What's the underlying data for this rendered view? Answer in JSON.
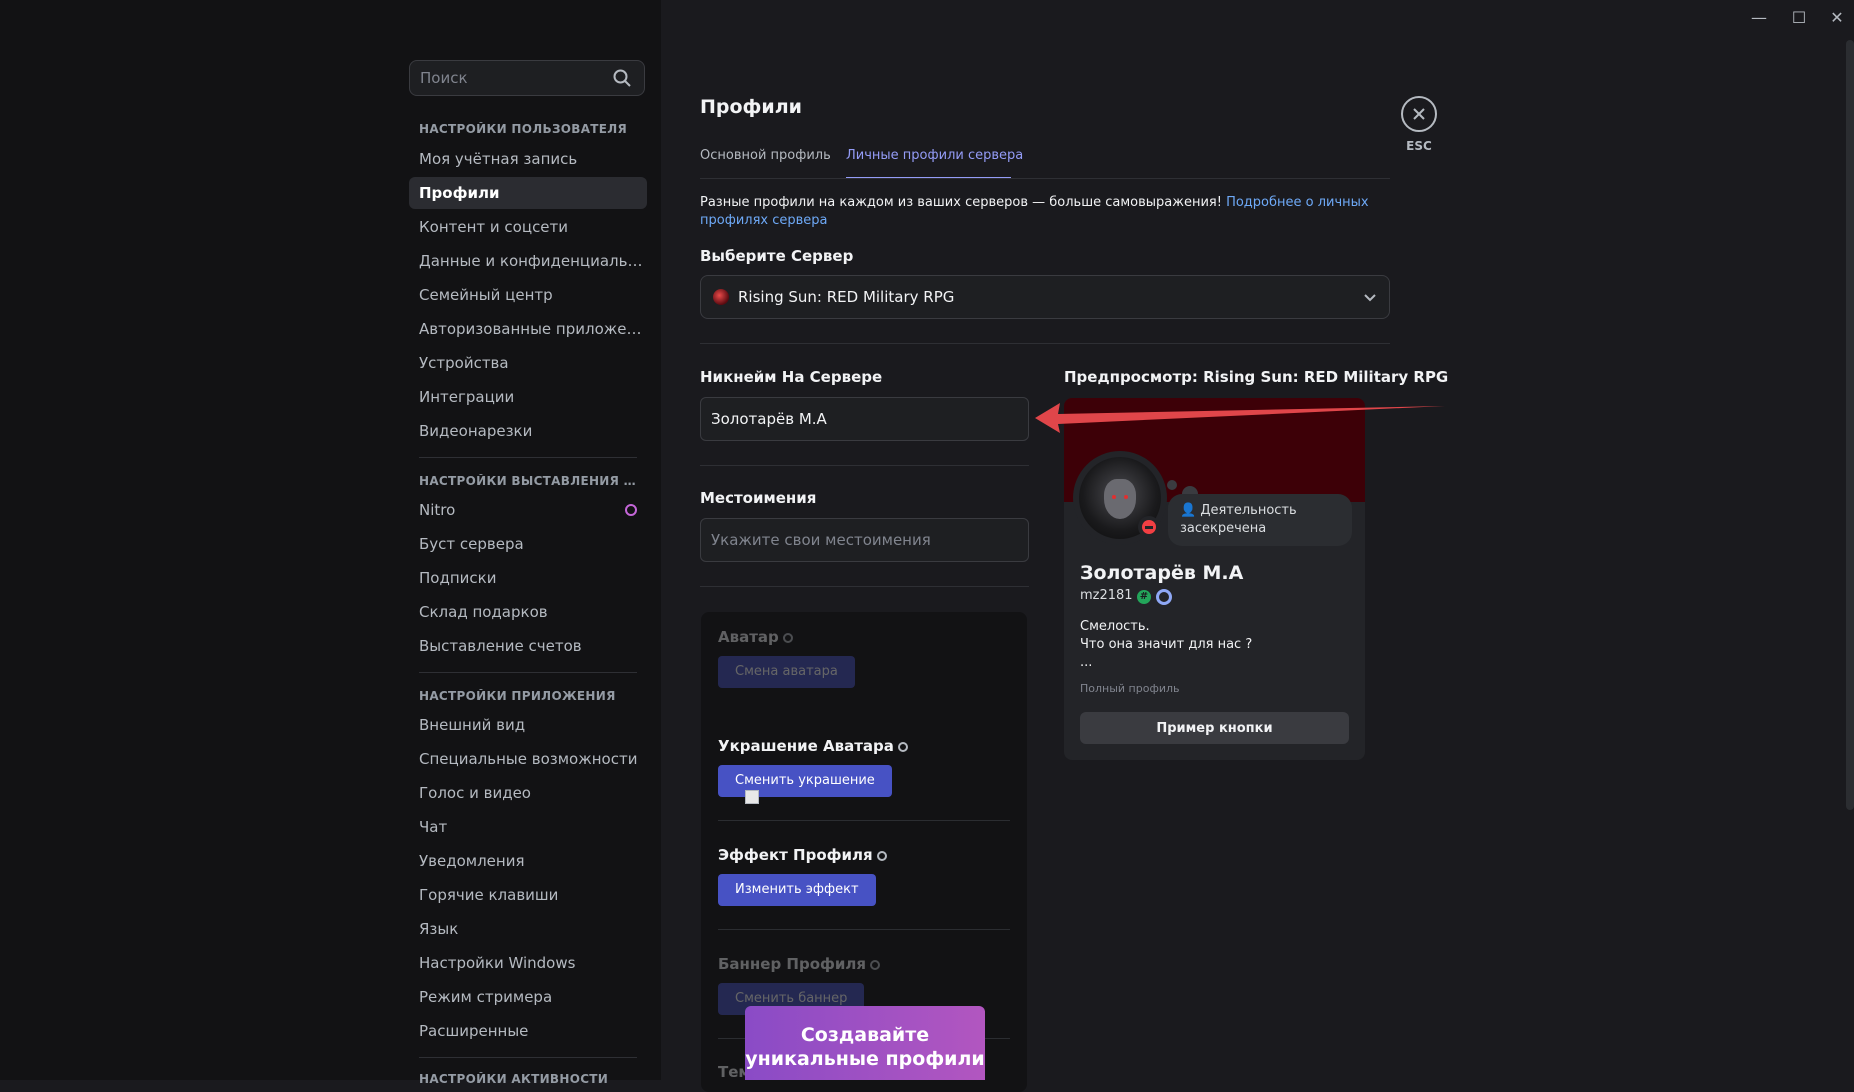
{
  "window": {
    "minimize": "—",
    "maximize": "☐",
    "close": "✕"
  },
  "search": {
    "placeholder": "Поиск",
    "icon": "search-icon"
  },
  "sidebar": {
    "sections": [
      {
        "title": "НАСТРОЙКИ ПОЛЬЗОВАТЕЛЯ",
        "items": [
          "Моя учётная запись",
          "Профили",
          "Контент и соцсети",
          "Данные и конфиденциальность",
          "Семейный центр",
          "Авторизованные приложения",
          "Устройства",
          "Интеграции",
          "Видеонарезки"
        ]
      },
      {
        "title": "НАСТРОЙКИ ВЫСТАВЛЕНИЯ СЧЕТОВ",
        "items": [
          "Nitro",
          "Буст сервера",
          "Подписки",
          "Склад подарков",
          "Выставление счетов"
        ]
      },
      {
        "title": "НАСТРОЙКИ ПРИЛОЖЕНИЯ",
        "items": [
          "Внешний вид",
          "Специальные возможности",
          "Голос и видео",
          "Чат",
          "Уведомления",
          "Горячие клавиши",
          "Язык",
          "Настройки Windows",
          "Режим стримера",
          "Расширенные"
        ]
      },
      {
        "title": "НАСТРОЙКИ АКТИВНОСТИ",
        "items": []
      }
    ],
    "active_item": "Профили"
  },
  "main": {
    "title": "Профили",
    "tabs": [
      {
        "label": "Основной профиль",
        "active": false
      },
      {
        "label": "Личные профили сервера",
        "active": true
      }
    ],
    "intro_text": "Разные профили на каждом из ваших серверов — больше самовыражения! ",
    "intro_link": "Подробнее о личных профилях сервера",
    "server_label": "Выберите Сервер",
    "server_selected": "Rising Sun: RED Military RPG",
    "nickname_label": "Никнейм На Сервере",
    "nickname_value": "Золотарёв М.А",
    "pronouns_label": "Местоимения",
    "pronouns_placeholder": "Укажите свои местоимения",
    "upgrades": {
      "avatar_label": "Аватар",
      "avatar_button": "Смена аватара",
      "decoration_label": "Украшение Аватара",
      "decoration_button": "Сменить украшение",
      "effect_label": "Эффект Профиля",
      "effect_button": "Изменить эффект",
      "banner_label": "Баннер Профиля",
      "banner_button": "Сменить баннер",
      "theme_label": "Тем"
    },
    "promo": "Создавайте уникальные профили"
  },
  "preview": {
    "title": "Предпросмотр: Rising Sun: RED Military RPG",
    "status_bubble": "👤 Деятельность засекречена",
    "display_name": "Золотарёв М.А",
    "username": "mz2181",
    "badge_hash": "#",
    "bio": "Смелость.\nЧто она значит для нас ?\n...",
    "full_profile": "Полный профиль",
    "button": "Пример кнопки",
    "banner_color": "#3d0007",
    "status": "dnd"
  },
  "close": {
    "label": "ESC",
    "icon": "close-icon"
  },
  "colors": {
    "accent": "#949cf7",
    "button": "#4752c4",
    "link": "#6ea9f7",
    "dnd": "#f23f43",
    "arrow": "#e0464a"
  }
}
